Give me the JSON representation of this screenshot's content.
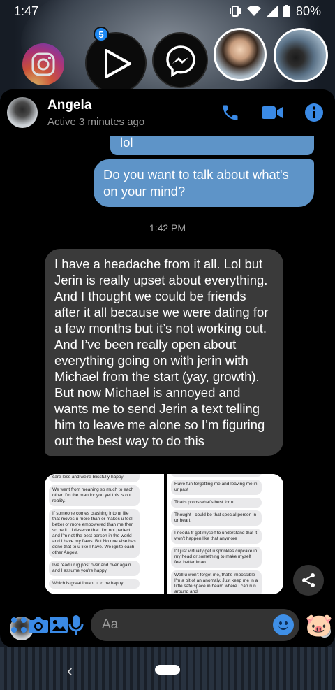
{
  "status_bar": {
    "time": "1:47",
    "battery": "80%"
  },
  "chat_heads": {
    "badge_count": "5"
  },
  "conversation": {
    "contact_name": "Angela",
    "contact_status": "Active 3 minutes ago"
  },
  "messages": {
    "outgoing_1": "lol",
    "outgoing_2": "Do you want to talk about what's on your mind?",
    "timestamp": "1:42 PM",
    "incoming_1": "I have a headache from it all. Lol but Jerin is really upset about everything. And I thought we could be friends after it all because we were dating for a few months but it’s not working out. And I’ve been really open about everything going on with jerin with Michael from the start (yay, growth). But now Michael is annoyed and wants me to send Jerin a text telling him to leave me alone so I’m figuring out the best way to do this"
  },
  "screenshot_left": [
    "care less and we're blissfully happy",
    "We went from meaning so much to each other. I'm the man for you yet this is our reality.",
    "If someone comes crashing into ur life that moves u more than or makes u feel better or more empowered than me then so be it. U deserve that. I'm not perfect and I'm not the best person in the world and I have my flaws. But No one else has done that to u like I have. We ignite each other Angela",
    "I've read ur ig post over and over again and I assume you're happy.",
    "Which is great I want u to be happy"
  ],
  "screenshot_right": [
    "Have fun forgetting me and leaving me in ur past",
    "That's probs what's best for u",
    "Thought I could be that special person in ur heart",
    "I needa fr get myself to understand that it won't happen like that anymore",
    "I'll just virtually get u sprinkles cupcake in my head or something to make myself feel better lmao",
    "Well u won't  forget me, that's impossible I'm a bit of an anomaly. Just keep me in a little safe space in heard  where I can run around and"
  ],
  "composer": {
    "placeholder": "Aa"
  },
  "colors": {
    "accent": "#3a8ae6",
    "outgoing_bubble": "#5e94c8",
    "incoming_bubble": "#3a3a3a"
  },
  "icons": [
    "instagram-icon",
    "play-icon",
    "messenger-icon",
    "phone-icon",
    "video-icon",
    "info-icon",
    "share-icon",
    "apps-icon",
    "camera-icon",
    "gallery-icon",
    "mic-icon",
    "emoji-icon",
    "pig-sticker-icon"
  ]
}
